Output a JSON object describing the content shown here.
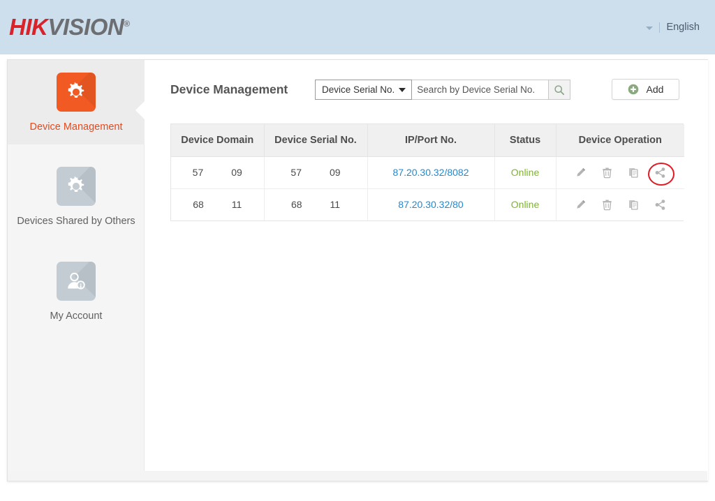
{
  "header": {
    "logo": {
      "part1": "HIK",
      "part2": "VISION",
      "registered": "®"
    },
    "language": {
      "label": "English",
      "caret_icon": "chevron-down-icon"
    }
  },
  "sidebar": {
    "items": [
      {
        "label": "Device Management",
        "icon": "gear-icon",
        "active": true
      },
      {
        "label": "Devices Shared by Others",
        "icon": "gear-icon",
        "active": false
      },
      {
        "label": "My Account",
        "icon": "user-info-icon",
        "active": false
      }
    ]
  },
  "main": {
    "page_title": "Device Management",
    "search": {
      "selected_option": "Device Serial No.",
      "options": [
        "Device Serial No."
      ],
      "placeholder": "Search by Device Serial No.",
      "value": "",
      "search_icon": "magnifier-icon"
    },
    "add_button": {
      "label": "Add",
      "icon": "plus-circle-icon"
    },
    "table": {
      "columns": [
        "Device Domain",
        "Device Serial No.",
        "IP/Port No.",
        "Status",
        "Device Operation"
      ],
      "rows": [
        {
          "device_domain_prefix": "57",
          "device_domain_suffix": "09",
          "device_serial_prefix": "57",
          "device_serial_suffix": "09",
          "ip_port": "87.20.30.32/8082",
          "status": "Online",
          "operations": [
            "edit-icon",
            "delete-icon",
            "copy-icon",
            "share-icon"
          ],
          "highlighted_operation": "share-icon"
        },
        {
          "device_domain_prefix": "68",
          "device_domain_suffix": "11",
          "device_serial_prefix": "68",
          "device_serial_suffix": "11",
          "ip_port": "87.20.30.32/80",
          "status": "Online",
          "operations": [
            "edit-icon",
            "delete-icon",
            "copy-icon",
            "share-icon"
          ],
          "highlighted_operation": null
        }
      ]
    }
  },
  "colors": {
    "brand_red": "#d8232a",
    "brand_gray": "#6d6e71",
    "accent_orange": "#f15a22",
    "header_blue": "#cddeed",
    "link_blue": "#1f8ad2",
    "status_green": "#7cb52c",
    "highlight_red": "#e01b24"
  }
}
